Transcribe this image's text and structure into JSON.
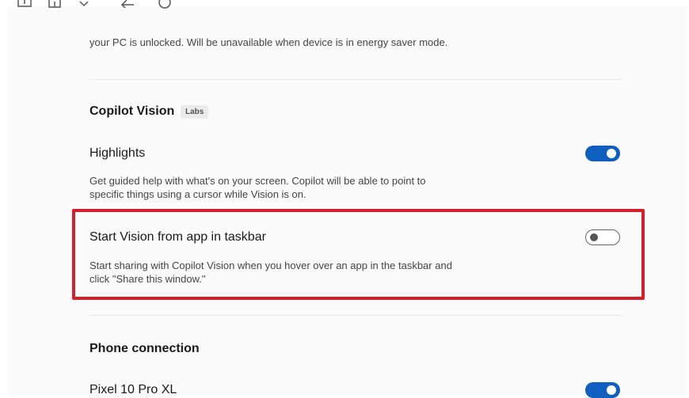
{
  "top": {
    "partial_description": "your PC is unlocked. Will be unavailable when device is in energy saver mode."
  },
  "copilot_vision": {
    "section_title": "Copilot Vision",
    "badge": "Labs",
    "highlights": {
      "title": "Highlights",
      "description_line1": "Get guided help with what's on your screen. Copilot will be able to point to",
      "description_line2": "specific things using a cursor while Vision is on.",
      "toggle_on": true
    },
    "start_vision": {
      "title": "Start Vision from app in taskbar",
      "description_line1": "Start sharing with Copilot Vision when you hover over an app in the taskbar and",
      "description_line2": "click \"Share this window.\"",
      "toggle_on": false
    }
  },
  "phone_connection": {
    "section_title": "Phone connection",
    "device": {
      "title": "Pixel 10 Pro XL",
      "toggle_on": true
    }
  },
  "colors": {
    "accent": "#0f5fc1",
    "highlight_border": "#d61f2b"
  },
  "icons": [
    "app-icon",
    "home-icon",
    "chevron-down-icon",
    "back-arrow-icon",
    "refresh-icon"
  ]
}
